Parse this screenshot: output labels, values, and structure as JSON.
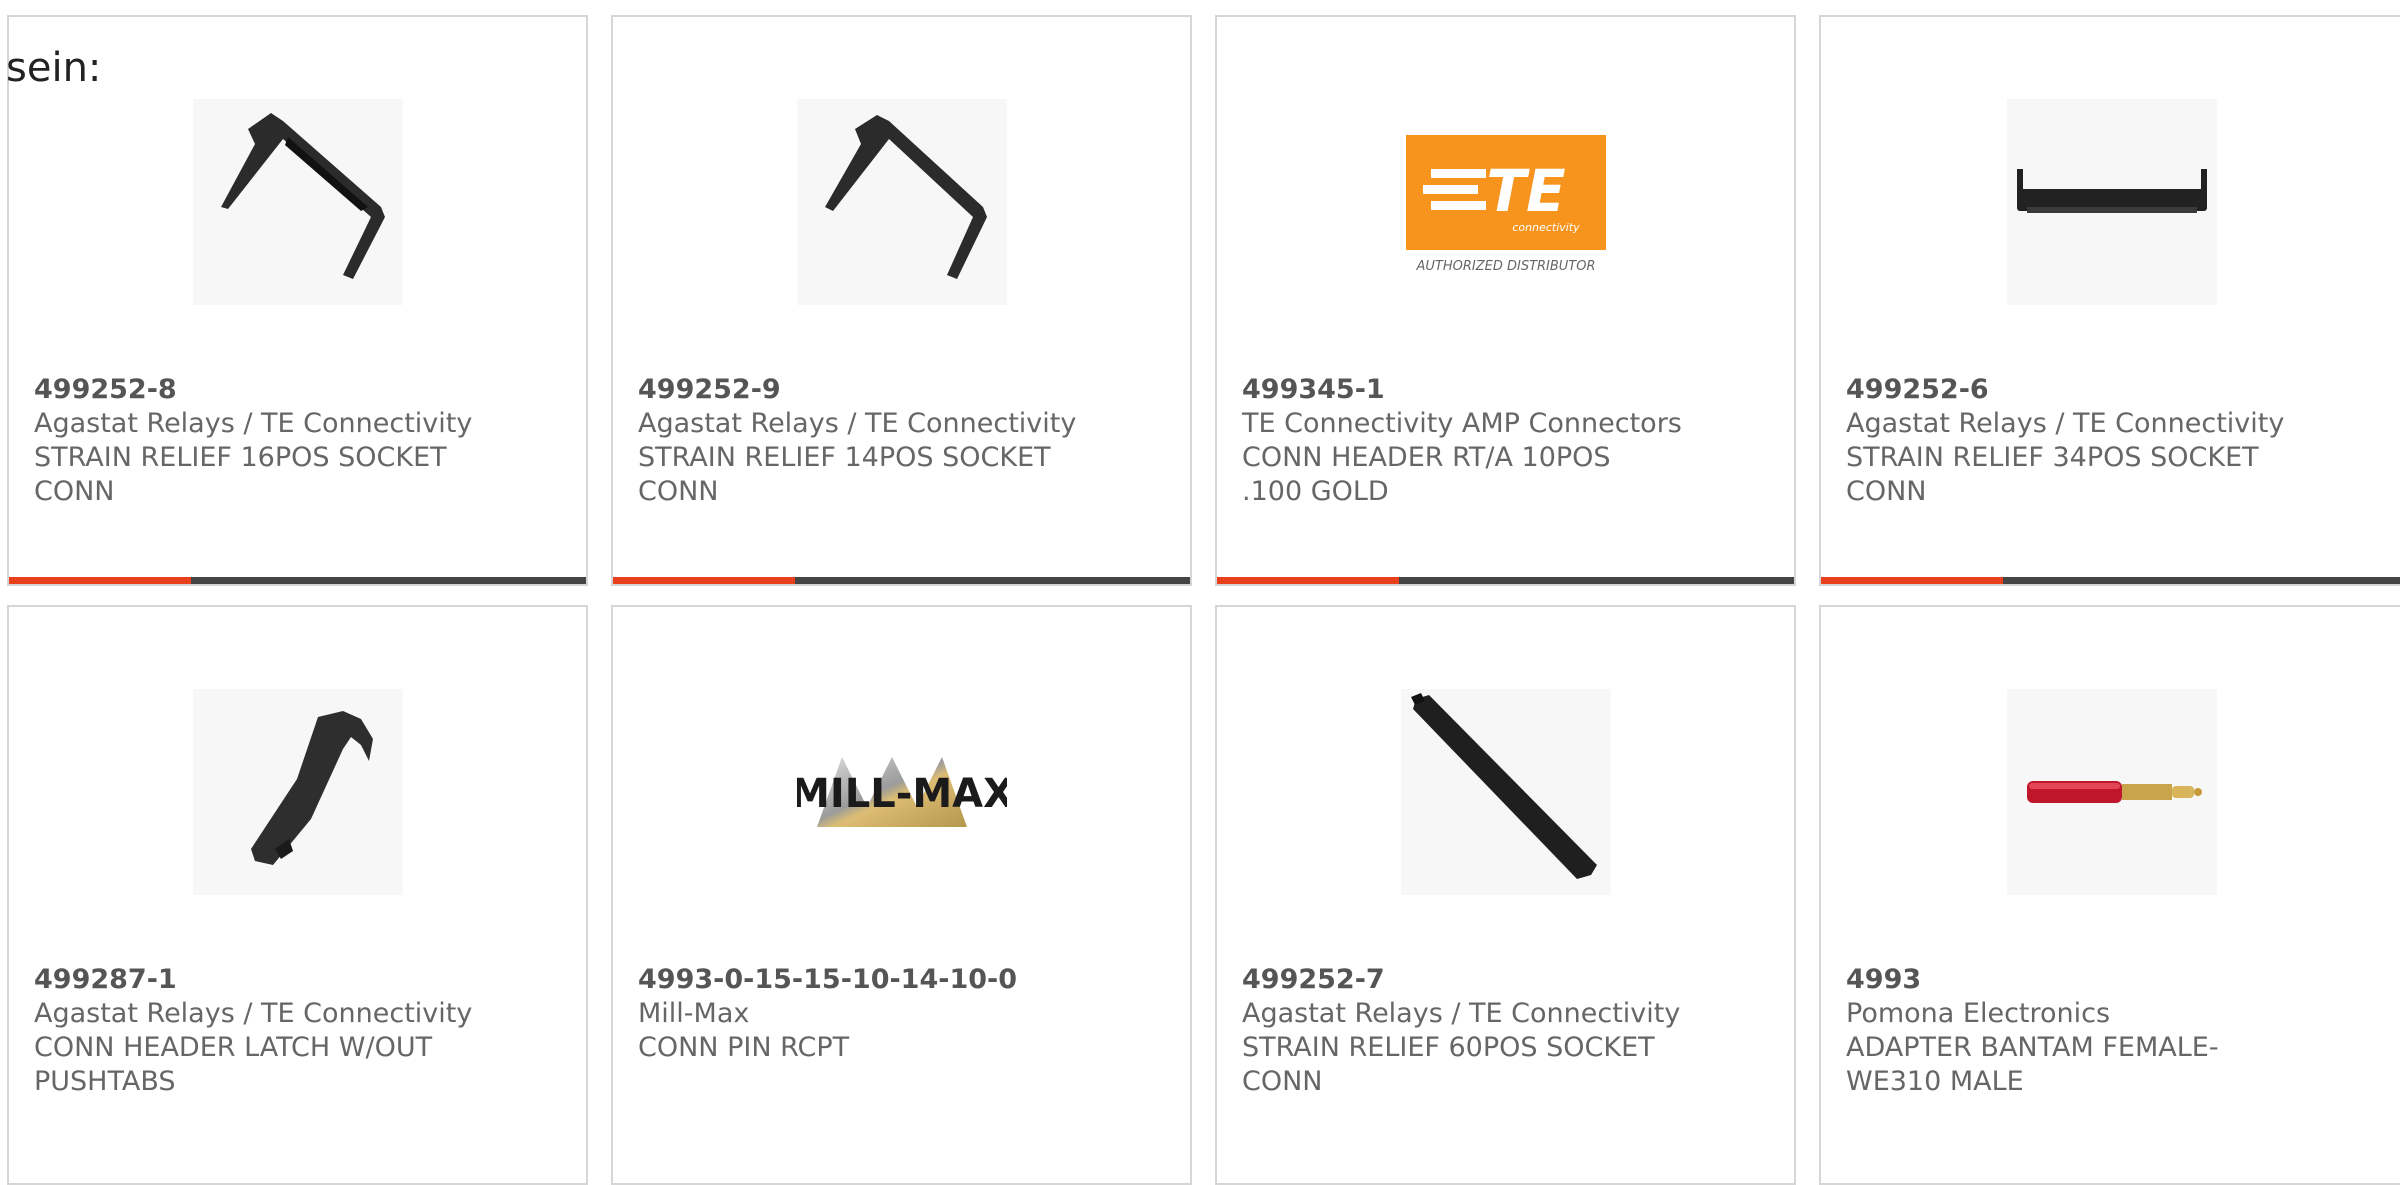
{
  "page": {
    "label": "sein:",
    "accent_color": "#e8401c",
    "bar_color": "#444444"
  },
  "products": [
    {
      "part": "499252-8",
      "brand": "Agastat Relays / TE Connectivity",
      "description": "STRAIN RELIEF 16POS SOCKET CONN",
      "image": "strain-relief-clip-image"
    },
    {
      "part": "499252-9",
      "brand": "Agastat Relays / TE Connectivity",
      "description": "STRAIN RELIEF 14POS SOCKET CONN",
      "image": "strain-relief-clip-image"
    },
    {
      "part": "499345-1",
      "brand": "TE Connectivity AMP Connectors",
      "description": "CONN HEADER RT/A 10POS .100 GOLD",
      "image": "te-connectivity-logo",
      "logo_text": "TE",
      "logo_subtext": "connectivity",
      "logo_caption": "AUTHORIZED DISTRIBUTOR"
    },
    {
      "part": "499252-6",
      "brand": "Agastat Relays / TE Connectivity",
      "description": "STRAIN RELIEF 34POS SOCKET CONN",
      "image": "strain-relief-bar-image"
    },
    {
      "part": "499287-1",
      "brand": "Agastat Relays / TE Connectivity",
      "description": "CONN HEADER LATCH W/OUT PUSHTABS",
      "image": "header-latch-image"
    },
    {
      "part": "4993-0-15-15-10-14-10-0",
      "brand": "Mill-Max",
      "description": "CONN PIN RCPT",
      "image": "mill-max-logo",
      "logo_text": "MILL-MAX"
    },
    {
      "part": "499252-7",
      "brand": "Agastat Relays / TE Connectivity",
      "description": "STRAIN RELIEF 60POS SOCKET CONN",
      "image": "strain-relief-long-bar-image"
    },
    {
      "part": "4993",
      "brand": "Pomona Electronics",
      "description": "ADAPTER BANTAM FEMALE-WE310 MALE",
      "image": "bantam-adapter-image"
    }
  ]
}
